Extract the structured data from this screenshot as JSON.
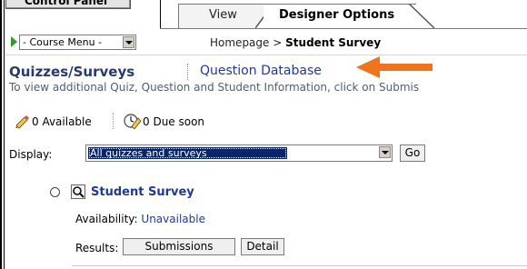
{
  "top": {
    "control_panel_label": "Control Panel"
  },
  "tabs": [
    {
      "label": "View"
    },
    {
      "label": "Designer Options"
    }
  ],
  "nav": {
    "course_menu_value": "- Course Menu -",
    "breadcrumb_parent": "Homepage",
    "breadcrumb_separator": ">",
    "breadcrumb_current": "Student Survey"
  },
  "page": {
    "title": "Quizzes/Surveys",
    "question_database_link": "Question Database",
    "instructions": "To view additional Quiz, Question and Student Information, click on Submis"
  },
  "counts": {
    "available": "0 Available",
    "due_soon": "0 Due soon"
  },
  "filter": {
    "label": "Display:",
    "selected": "All quizzes and surveys",
    "go_label": "Go"
  },
  "item": {
    "title": "Student Survey",
    "availability_label": "Availability:",
    "availability_value": "Unavailable",
    "results_label": "Results:",
    "submissions_label": "Submissions",
    "detail_label": "Detail"
  },
  "colors": {
    "heading": "#243a73",
    "link": "#1f3a93",
    "annotation_arrow": "#f0731e",
    "selection": "#0a246a"
  }
}
